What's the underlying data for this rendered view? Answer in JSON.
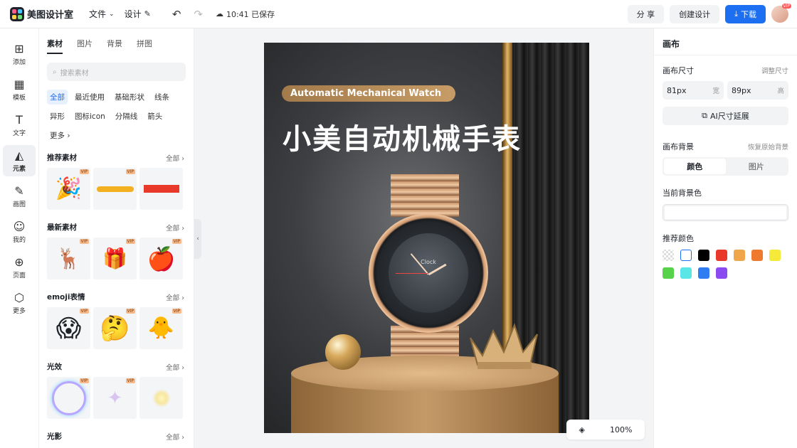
{
  "app": {
    "name": "美图设计室"
  },
  "topbar": {
    "menu_file": "文件",
    "menu_design": "设计",
    "save_status": "10:41 已保存",
    "share_label": "分 享",
    "create_label": "创建设计",
    "download_label": "下载",
    "avatar_badge": "VIP"
  },
  "leftnav": {
    "items": [
      {
        "label": "添加",
        "icon": "plus-icon",
        "glyph": "⊞"
      },
      {
        "label": "模板",
        "icon": "template-icon",
        "glyph": "▦"
      },
      {
        "label": "文字",
        "icon": "text-icon",
        "glyph": "T"
      },
      {
        "label": "元素",
        "icon": "shapes-icon",
        "glyph": "◭"
      },
      {
        "label": "画图",
        "icon": "pen-icon",
        "glyph": "✎"
      },
      {
        "label": "我的",
        "icon": "user-icon",
        "glyph": "☺"
      },
      {
        "label": "页面",
        "icon": "page-add-icon",
        "glyph": "⊕"
      },
      {
        "label": "更多",
        "icon": "cube-icon",
        "glyph": "⬡"
      }
    ]
  },
  "panel": {
    "tabs": [
      "素材",
      "图片",
      "背景",
      "拼图"
    ],
    "search_placeholder": "搜索素材",
    "chips": [
      "全部",
      "最近使用",
      "基础形状",
      "线条",
      "异形",
      "图标icon",
      "分隔线",
      "箭头",
      "更多"
    ],
    "all_label": "全部",
    "vip_label": "VIP",
    "sections": [
      {
        "title": "推荐素材"
      },
      {
        "title": "最新素材"
      },
      {
        "title": "emoji表情"
      },
      {
        "title": "光效"
      },
      {
        "title": "光影"
      }
    ]
  },
  "canvas": {
    "badge_text": "Automatic Mechanical Watch",
    "headline": "小美自动机械手表",
    "watch_brand": "Clock"
  },
  "zoom": {
    "value": "100%"
  },
  "rpanel": {
    "title": "画布",
    "size_label": "画布尺寸",
    "adjust_size": "调整尺寸",
    "width_value": "81px",
    "width_unit": "宽",
    "height_value": "89px",
    "height_unit": "高",
    "ai_extend": "AI尺寸延展",
    "bg_label": "画布背景",
    "restore_bg": "恢复原始背景",
    "seg_color": "颜色",
    "seg_image": "图片",
    "current_bg": "当前背景色",
    "recommend_label": "推荐颜色",
    "swatches": [
      "transparent",
      "#ffffff",
      "#000000",
      "#e8392b",
      "#f0a64a",
      "#ee7a30",
      "#f5ea3a",
      "#56d34a",
      "#5ae6e6",
      "#2f7df0",
      "#8a4cf0"
    ]
  },
  "colors": {
    "accent": "#1d6ff2"
  }
}
